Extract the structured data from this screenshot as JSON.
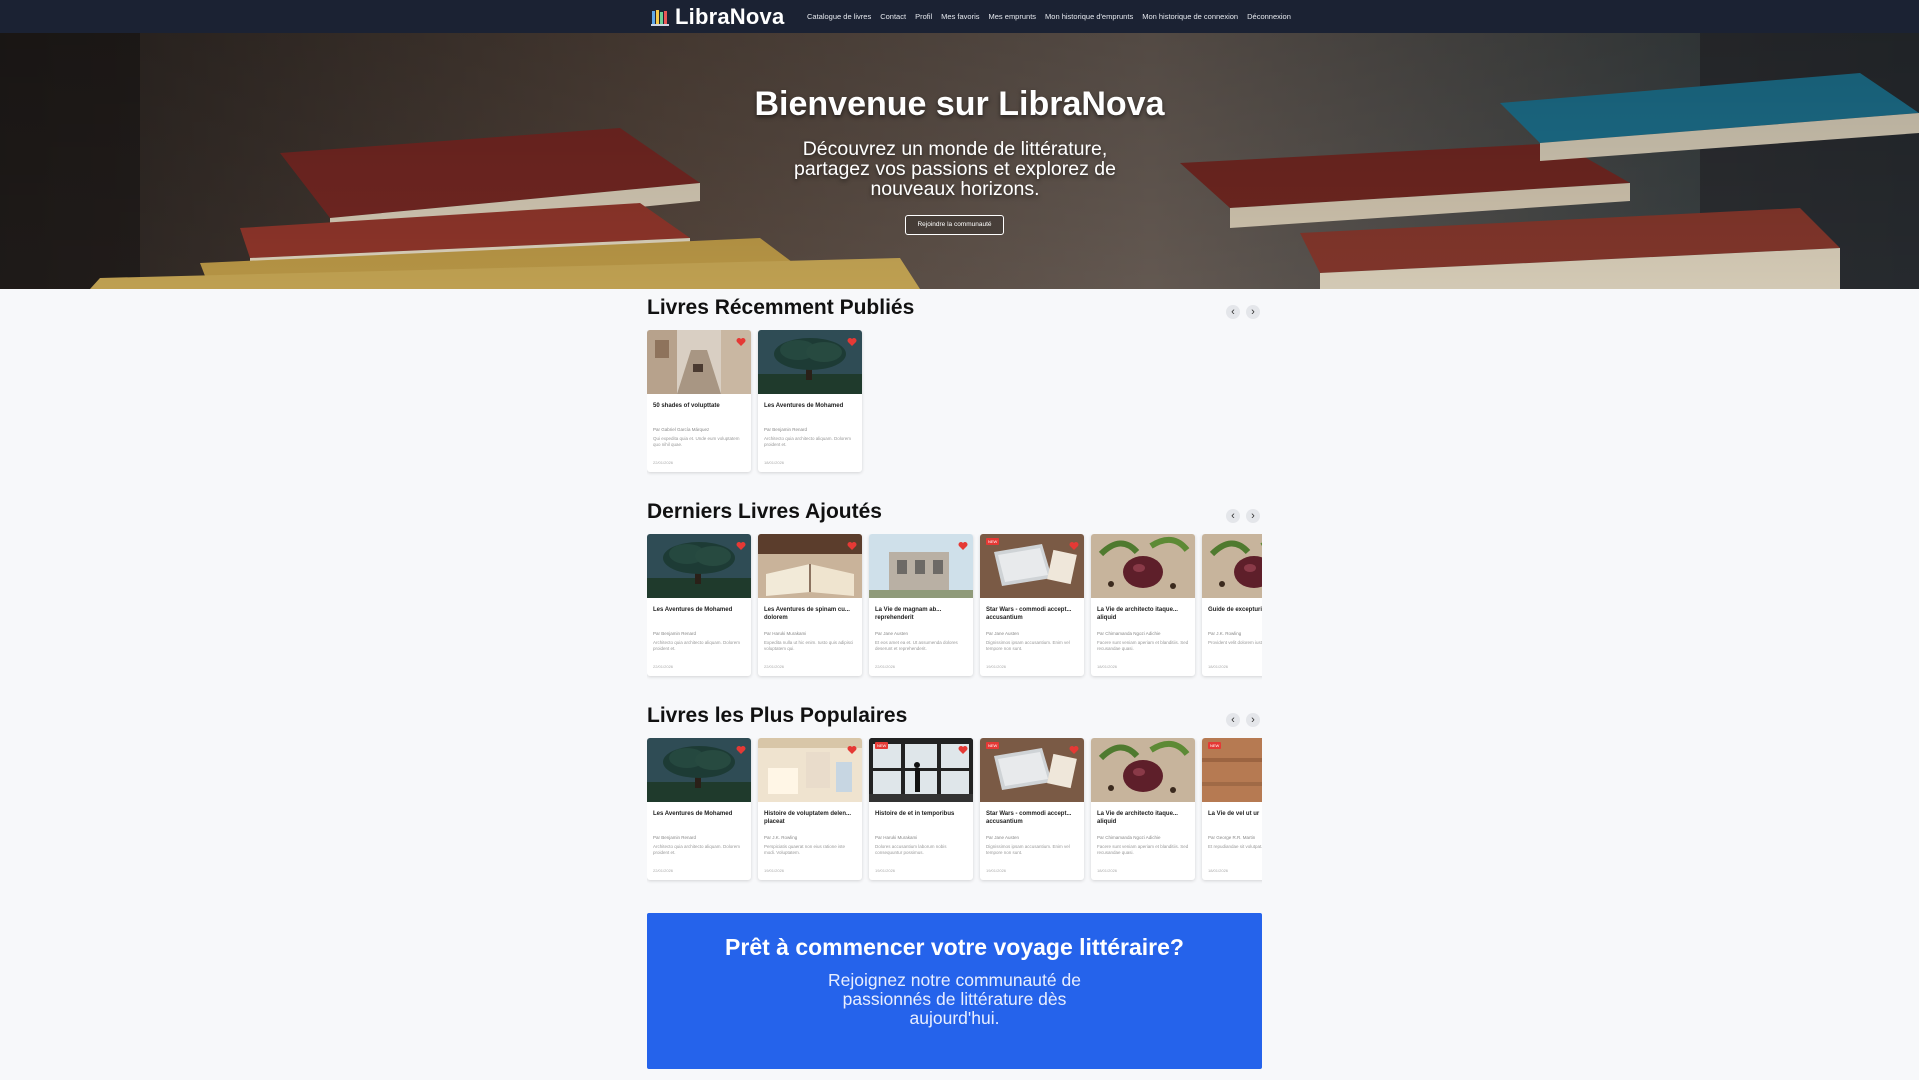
{
  "brand": {
    "name": "LibraNova"
  },
  "nav": {
    "links": [
      "Catalogue de livres",
      "Contact",
      "Profil",
      "Mes favoris",
      "Mes emprunts",
      "Mon historique d'emprunts",
      "Mon historique de connexion",
      "Déconnexion"
    ]
  },
  "hero": {
    "title": "Bienvenue sur LibraNova",
    "subtitle": "Découvrez un monde de littérature, partagez vos passions et explorez de nouveaux horizons.",
    "button": "Rejoindre la communauté"
  },
  "sections": [
    {
      "title": "Livres Récemment Publiés",
      "prev_icon": "‹",
      "next_icon": "›",
      "cards": [
        {
          "image": "street",
          "title": "50 shades of volupttate",
          "author": "Par Gabriel García Márquez",
          "desc": "Qui expedita quia et. Unde eum voluptatem quo nihil quae.",
          "date": "22/01/2026",
          "new": false,
          "favorite": true
        },
        {
          "image": "tree",
          "title": "Les Aventures de Mohamed",
          "author": "Par Benjamin Renard",
          "desc": "Architecto quia architecto aliquam. Dolorem proident et.",
          "date": "18/01/2026",
          "new": false,
          "favorite": true
        }
      ]
    },
    {
      "title": "Derniers Livres Ajoutés",
      "prev_icon": "‹",
      "next_icon": "›",
      "cards": [
        {
          "image": "tree",
          "title": "Les Aventures de Mohamed",
          "author": "Par Benjamin Renard",
          "desc": "Architecto quia architecto aliquam. Dolorem proident et.",
          "date": "22/01/2026",
          "new": false,
          "favorite": true
        },
        {
          "image": "openbook",
          "title": "Les Aventures de spinam cu... dolorem",
          "author": "Par Haruki Murakami",
          "desc": "Expedita nulla ut hic enim. Iusto quis adipisci voluptatem qui.",
          "date": "22/01/2026",
          "new": false,
          "favorite": true
        },
        {
          "image": "building",
          "title": "La Vie de magnam ab... reprehenderit",
          "author": "Par Jane Austen",
          "desc": "Et eos amet ea et. Ut assumenda dolores deserunt et reprehenderit.",
          "date": "22/01/2026",
          "new": false,
          "favorite": true
        },
        {
          "image": "laptop",
          "title": "Star Wars - commodi accept... accusantium",
          "author": "Par Jane Austen",
          "desc": "Dignissimos ipsam accusantium. Enim vel tempore non sunt.",
          "date": "19/01/2026",
          "new": true,
          "favorite": true
        },
        {
          "image": "food",
          "title": "La Vie de architecto itaque... aliquid",
          "author": "Par Chimamanda Ngozi Adichie",
          "desc": "Facere sunt veniam aperiam et blanditiis. Sed recusandae quasi.",
          "date": "18/01/2026",
          "new": false,
          "favorite": false
        },
        {
          "image": "food",
          "title": "Guide de excepturi",
          "author": "Par J.K. Rowling",
          "desc": "Provident velit dolorem iusto veritatis sed.",
          "date": "18/01/2026",
          "new": false,
          "favorite": false
        }
      ]
    },
    {
      "title": "Livres les Plus Populaires",
      "prev_icon": "‹",
      "next_icon": "›",
      "cards": [
        {
          "image": "tree",
          "title": "Les Aventures de Mohamed",
          "author": "Par Benjamin Renard",
          "desc": "Architecto quia architecto aliquam. Dolorem proident et.",
          "date": "22/01/2026",
          "new": false,
          "favorite": true
        },
        {
          "image": "desk",
          "title": "Histoire de voluptatem delen... placeat",
          "author": "Par J.K. Rowling",
          "desc": "Perspiciatis quaerat non eius ratione iste modi. Voluptatem.",
          "date": "19/01/2026",
          "new": false,
          "favorite": true
        },
        {
          "image": "window",
          "title": "Histoire de et in temporibus",
          "author": "Par Haruki Murakami",
          "desc": "Dolores accusantium laborum nobis consequuntur possimus.",
          "date": "19/01/2026",
          "new": true,
          "favorite": true
        },
        {
          "image": "laptop",
          "title": "Star Wars - commodi accept... accusantium",
          "author": "Par Jane Austen",
          "desc": "Dignissimos ipsam accusantium. Enim vel tempore non sunt.",
          "date": "19/01/2026",
          "new": true,
          "favorite": true
        },
        {
          "image": "food",
          "title": "La Vie de architecto itaque... aliquid",
          "author": "Par Chimamanda Ngozi Adichie",
          "desc": "Facere sunt veniam aperiam et blanditiis. Sed recusandae quasi.",
          "date": "18/01/2026",
          "new": false,
          "favorite": false
        },
        {
          "image": "wood",
          "title": "La Vie de vel ut ur",
          "author": "Par George R.R. Martin",
          "desc": "Et repudiandae sit volutpat. Sed amet et sunt.",
          "date": "18/01/2026",
          "new": true,
          "favorite": false
        }
      ]
    }
  ],
  "cta": {
    "title": "Prêt à commencer votre voyage littéraire?",
    "text": "Rejoignez notre communauté de passionnés de littérature dès aujourd'hui."
  },
  "badge_label": "NEW",
  "colors": {
    "navbar": "#1b2233",
    "cta": "#2563eb",
    "favorite": "#e53935"
  }
}
